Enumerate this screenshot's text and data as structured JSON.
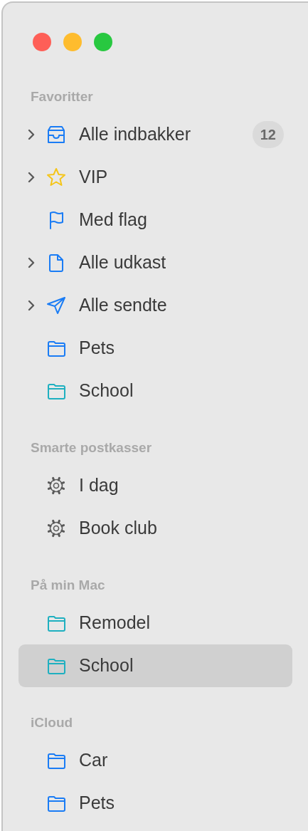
{
  "window": {
    "controls": [
      {
        "color": "#fe5f57"
      },
      {
        "color": "#febc2e"
      },
      {
        "color": "#28c840"
      }
    ]
  },
  "sidebar": {
    "sections": [
      {
        "title": "Favoritter",
        "items": [
          {
            "label": "Alle indbakker",
            "kind": "inbox",
            "color": "#1a7cf5",
            "collapsed": true,
            "badge": "12",
            "selected": false
          },
          {
            "label": "VIP",
            "kind": "star",
            "color": "#f5c518",
            "collapsed": true,
            "selected": false
          },
          {
            "label": "Med flag",
            "kind": "flag",
            "color": "#1a7cf5",
            "selected": false
          },
          {
            "label": "Alle udkast",
            "kind": "document",
            "color": "#1a7cf5",
            "collapsed": true,
            "selected": false
          },
          {
            "label": "Alle sendte",
            "kind": "send",
            "color": "#1a7cf5",
            "collapsed": true,
            "selected": false
          },
          {
            "label": "Pets",
            "kind": "folder",
            "color": "#1a7cf5",
            "selected": false
          },
          {
            "label": "School",
            "kind": "folder",
            "color": "#1fb0c0",
            "selected": false
          }
        ]
      },
      {
        "title": "Smarte postkasser",
        "items": [
          {
            "label": "I dag",
            "kind": "gear",
            "color": "#5a5a5a",
            "selected": false
          },
          {
            "label": "Book club",
            "kind": "gear",
            "color": "#5a5a5a",
            "selected": false
          }
        ]
      },
      {
        "title": "På min Mac",
        "items": [
          {
            "label": "Remodel",
            "kind": "folder",
            "color": "#1fb0c0",
            "selected": false
          },
          {
            "label": "School",
            "kind": "folder",
            "color": "#1fb0c0",
            "selected": true
          }
        ]
      },
      {
        "title": "iCloud",
        "items": [
          {
            "label": "Car",
            "kind": "folder",
            "color": "#1a7cf5",
            "selected": false
          },
          {
            "label": "Pets",
            "kind": "folder",
            "color": "#1a7cf5",
            "selected": false
          }
        ]
      }
    ]
  }
}
